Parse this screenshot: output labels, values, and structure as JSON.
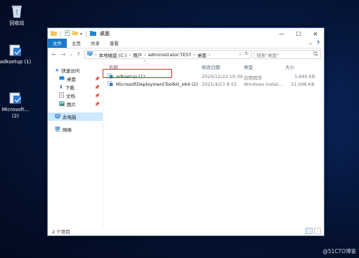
{
  "desktop": {
    "icons": [
      {
        "label": "回收站",
        "icon": "recycle-bin-icon"
      },
      {
        "label": "adksetup (1)",
        "icon": "installer-icon"
      },
      {
        "label": "Microsoft...\n(2)",
        "icon": "installer-icon"
      }
    ]
  },
  "window": {
    "title": "桌面",
    "ribbon_tabs": [
      "文件",
      "主页",
      "共享",
      "查看"
    ],
    "address_path": [
      "本地磁盘 (C:)",
      "用户",
      "administrator.TEST",
      "桌面"
    ],
    "search_placeholder": "搜索\"桌面\"",
    "nav_items": [
      {
        "label": "快速访问",
        "icon": "star-icon",
        "pinned": false
      },
      {
        "label": "桌面",
        "icon": "desktop-icon",
        "pinned": true
      },
      {
        "label": "下载",
        "icon": "download-icon",
        "pinned": true
      },
      {
        "label": "文档",
        "icon": "document-icon",
        "pinned": true
      },
      {
        "label": "图片",
        "icon": "picture-icon",
        "pinned": true
      },
      {
        "label": "此电脑",
        "icon": "computer-icon",
        "pinned": false
      },
      {
        "label": "网络",
        "icon": "network-icon",
        "pinned": false
      }
    ],
    "columns": {
      "name": "名称",
      "modified": "修改日期",
      "type": "类型",
      "size": "大小"
    },
    "files": [
      {
        "name": "adksetup (1)",
        "modified": "2020/12/22 10:39",
        "type": "应用程序",
        "size": "1,695 KB"
      },
      {
        "name": "MicrosoftDeploymentToolkit_x64 (2)",
        "modified": "2021/4/23 8:55",
        "type": "Windows Instal...",
        "size": "21,096 KB"
      }
    ],
    "status": "2 个项目"
  },
  "watermark": "@51CTO博客",
  "colors": {
    "accent": "#1979ca",
    "highlight_border": "#e02020",
    "selection": "#cce8ff"
  }
}
